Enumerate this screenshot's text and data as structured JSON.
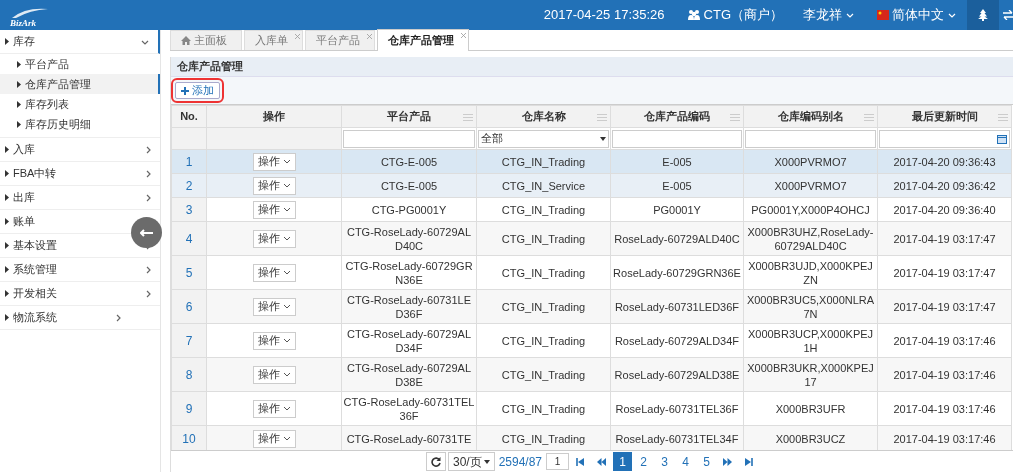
{
  "header": {
    "logo": "BizArk",
    "datetime": "2017-04-25 17:35:26",
    "account": "CTG（商户）",
    "user": "李龙祥",
    "language": "简体中文"
  },
  "sidebar": {
    "items": [
      {
        "label": "库存",
        "expanded": true,
        "children": [
          {
            "label": "平台产品",
            "selected": false
          },
          {
            "label": "仓库产品管理",
            "selected": true
          },
          {
            "label": "库存列表",
            "selected": false
          },
          {
            "label": "库存历史明细",
            "selected": false
          }
        ]
      },
      {
        "label": "入库",
        "expanded": false
      },
      {
        "label": "FBA中转",
        "expanded": false
      },
      {
        "label": "出库",
        "expanded": false
      },
      {
        "label": "账单",
        "expanded": false
      },
      {
        "label": "基本设置",
        "expanded": false
      },
      {
        "label": "系统管理",
        "expanded": false
      },
      {
        "label": "开发相关",
        "expanded": false
      },
      {
        "label": "物流系统",
        "expanded": false
      }
    ]
  },
  "tabs": [
    {
      "label": "主面板",
      "kind": "home",
      "selected": false
    },
    {
      "label": "入库单",
      "kind": "closable",
      "selected": false
    },
    {
      "label": "平台产品",
      "kind": "closable",
      "selected": false
    },
    {
      "label": "仓库产品管理",
      "kind": "closable",
      "selected": true
    }
  ],
  "panel_title": "仓库产品管理",
  "add_button": "添加",
  "table": {
    "columns": [
      "No.",
      "操作",
      "平台产品",
      "仓库名称",
      "仓库产品编码",
      "仓库编码别名",
      "最后更新时间"
    ],
    "filter_select": "全部",
    "rows": [
      {
        "no": "1",
        "action": "操作",
        "platform_product": "CTG-E-005",
        "warehouse": "CTG_IN_Trading",
        "code": "E-005",
        "alias": "X000PVRMO7",
        "updated": "2017-04-20 09:36:43",
        "selected": true,
        "hovered": false
      },
      {
        "no": "2",
        "action": "操作",
        "platform_product": "CTG-E-005",
        "warehouse": "CTG_IN_Service",
        "code": "E-005",
        "alias": "X000PVRMO7",
        "updated": "2017-04-20 09:36:42",
        "selected": false,
        "hovered": true
      },
      {
        "no": "3",
        "action": "操作",
        "platform_product": "CTG-PG0001Y",
        "warehouse": "CTG_IN_Trading",
        "code": "PG0001Y",
        "alias": "PG0001Y,X000P4OHCJ",
        "updated": "2017-04-20 09:36:40",
        "selected": false,
        "hovered": false
      },
      {
        "no": "4",
        "action": "操作",
        "platform_product": "CTG-RoseLady-60729ALD40C",
        "warehouse": "CTG_IN_Trading",
        "code": "RoseLady-60729ALD40C",
        "alias": "X000BR3UHZ,RoseLady-60729ALD40C",
        "updated": "2017-04-19 03:17:47",
        "selected": false,
        "hovered": false
      },
      {
        "no": "5",
        "action": "操作",
        "platform_product": "CTG-RoseLady-60729GRN36E",
        "warehouse": "CTG_IN_Trading",
        "code": "RoseLady-60729GRN36E",
        "alias": "X000BR3UJD,X000KPEJZN",
        "updated": "2017-04-19 03:17:47",
        "selected": false,
        "hovered": false
      },
      {
        "no": "6",
        "action": "操作",
        "platform_product": "CTG-RoseLady-60731LED36F",
        "warehouse": "CTG_IN_Trading",
        "code": "RoseLady-60731LED36F",
        "alias": "X000BR3UC5,X000NLRA7N",
        "updated": "2017-04-19 03:17:47",
        "selected": false,
        "hovered": false
      },
      {
        "no": "7",
        "action": "操作",
        "platform_product": "CTG-RoseLady-60729ALD34F",
        "warehouse": "CTG_IN_Trading",
        "code": "RoseLady-60729ALD34F",
        "alias": "X000BR3UCP,X000KPEJ1H",
        "updated": "2017-04-19 03:17:46",
        "selected": false,
        "hovered": false
      },
      {
        "no": "8",
        "action": "操作",
        "platform_product": "CTG-RoseLady-60729ALD38E",
        "warehouse": "CTG_IN_Trading",
        "code": "RoseLady-60729ALD38E",
        "alias": "X000BR3UKR,X000KPEJ17",
        "updated": "2017-04-19 03:17:46",
        "selected": false,
        "hovered": false
      },
      {
        "no": "9",
        "action": "操作",
        "platform_product": "CTG-RoseLady-60731TEL36F",
        "warehouse": "CTG_IN_Trading",
        "code": "RoseLady-60731TEL36F",
        "alias": "X000BR3UFR",
        "updated": "2017-04-19 03:17:46",
        "selected": false,
        "hovered": false
      },
      {
        "no": "10",
        "action": "操作",
        "platform_product": "CTG-RoseLady-60731TE",
        "warehouse": "CTG_IN_Trading",
        "code": "RoseLady-60731TEL34F",
        "alias": "X000BR3UCZ",
        "updated": "2017-04-19 03:17:46",
        "selected": false,
        "hovered": false
      }
    ]
  },
  "pager": {
    "page_size": "30/页",
    "total": "2594/87",
    "page_input": "1",
    "pages": [
      {
        "label": "1",
        "selected": true
      },
      {
        "label": "2",
        "selected": false
      },
      {
        "label": "3",
        "selected": false
      },
      {
        "label": "4",
        "selected": false
      },
      {
        "label": "5",
        "selected": false
      }
    ]
  }
}
